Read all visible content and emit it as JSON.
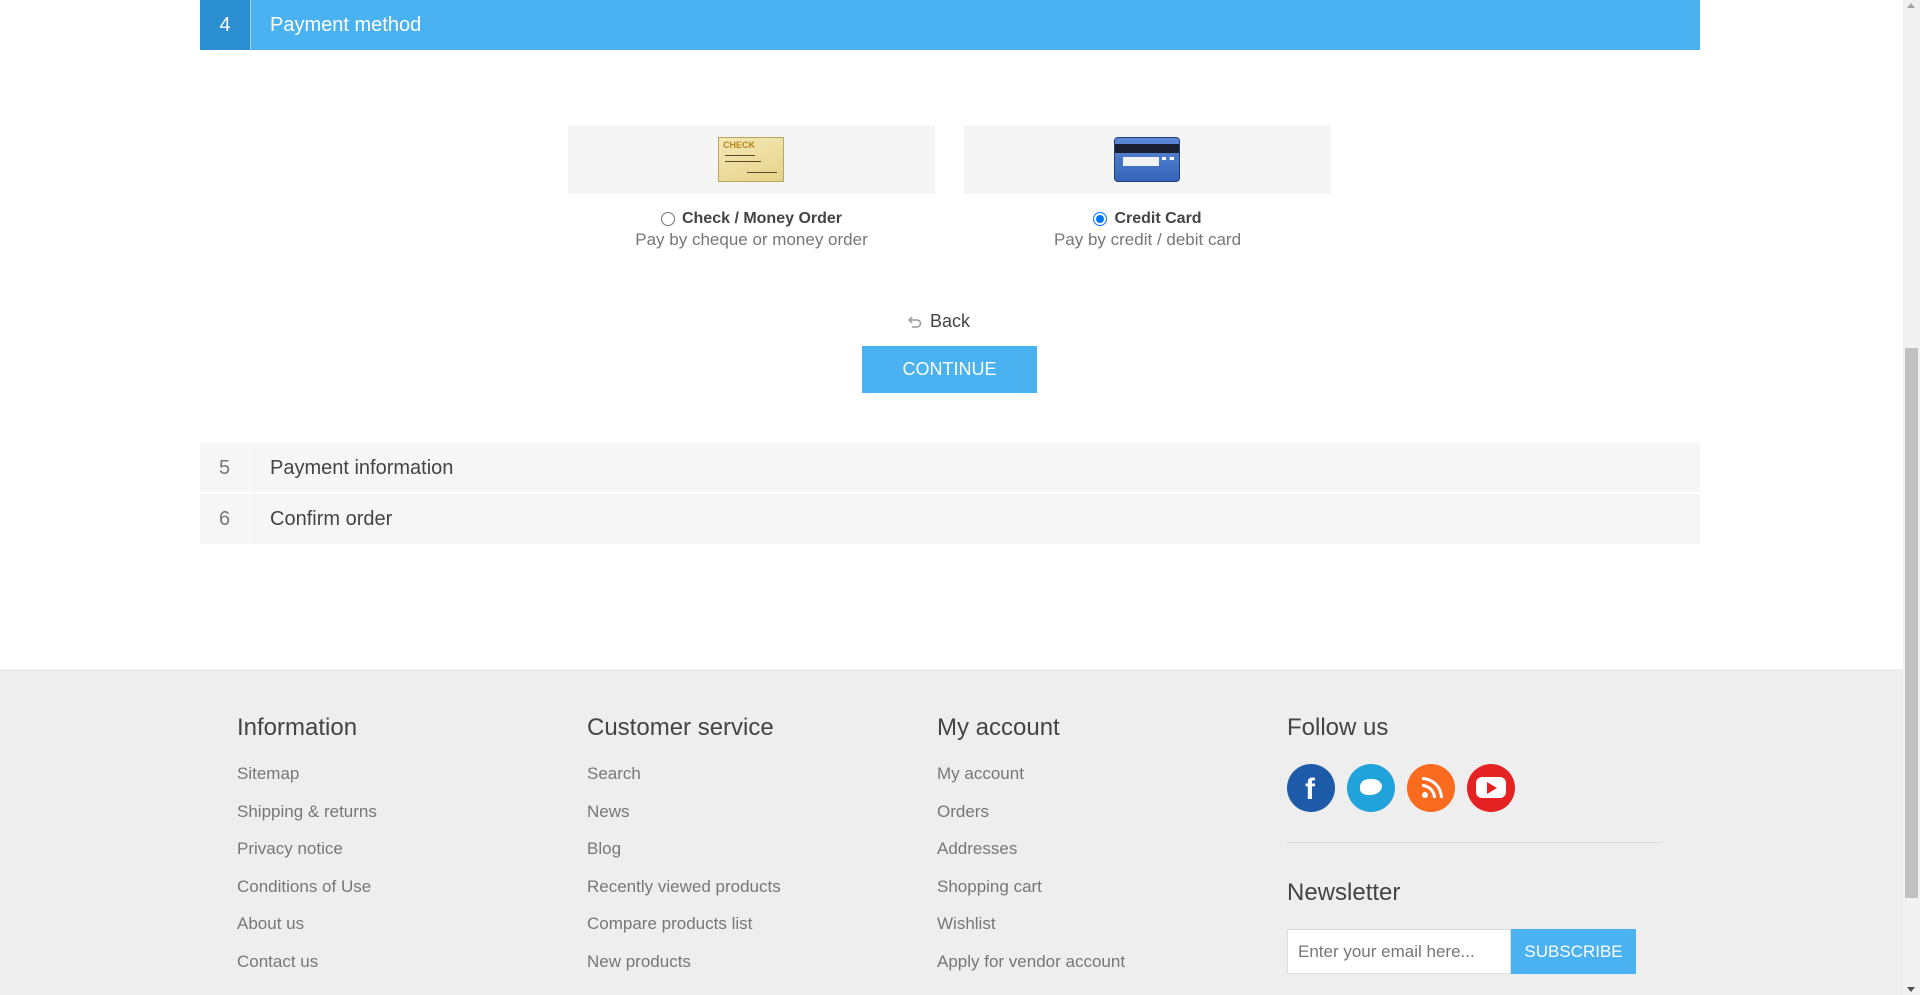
{
  "active_step": {
    "number": "4",
    "title": "Payment method"
  },
  "payment_methods": [
    {
      "name": "Check / Money Order",
      "description": "Pay by cheque or money order",
      "image_text": "CHECK",
      "selected": false
    },
    {
      "name": "Credit Card",
      "description": "Pay by credit / debit card",
      "selected": true
    }
  ],
  "back_label": "Back",
  "continue_label": "CONTINUE",
  "steps": [
    {
      "number": "5",
      "title": "Payment information"
    },
    {
      "number": "6",
      "title": "Confirm order"
    }
  ],
  "footer": {
    "information": {
      "title": "Information",
      "links": [
        "Sitemap",
        "Shipping & returns",
        "Privacy notice",
        "Conditions of Use",
        "About us",
        "Contact us"
      ]
    },
    "customer_service": {
      "title": "Customer service",
      "links": [
        "Search",
        "News",
        "Blog",
        "Recently viewed products",
        "Compare products list",
        "New products"
      ]
    },
    "my_account": {
      "title": "My account",
      "links": [
        "My account",
        "Orders",
        "Addresses",
        "Shopping cart",
        "Wishlist",
        "Apply for vendor account"
      ]
    },
    "follow_us": {
      "title": "Follow us",
      "icons": [
        "facebook-icon",
        "twitter-icon",
        "rss-icon",
        "youtube-icon"
      ],
      "colors": {
        "facebook": "#1d5aa7",
        "twitter": "#1fa3da",
        "rss": "#fa6a1f",
        "youtube": "#e52222"
      }
    },
    "newsletter": {
      "title": "Newsletter",
      "placeholder": "Enter your email here...",
      "button": "SUBSCRIBE"
    }
  },
  "colors": {
    "accent": "#4ab2f1",
    "accent_dark": "#2a8ed1",
    "footer_bg": "#eeeeee"
  }
}
